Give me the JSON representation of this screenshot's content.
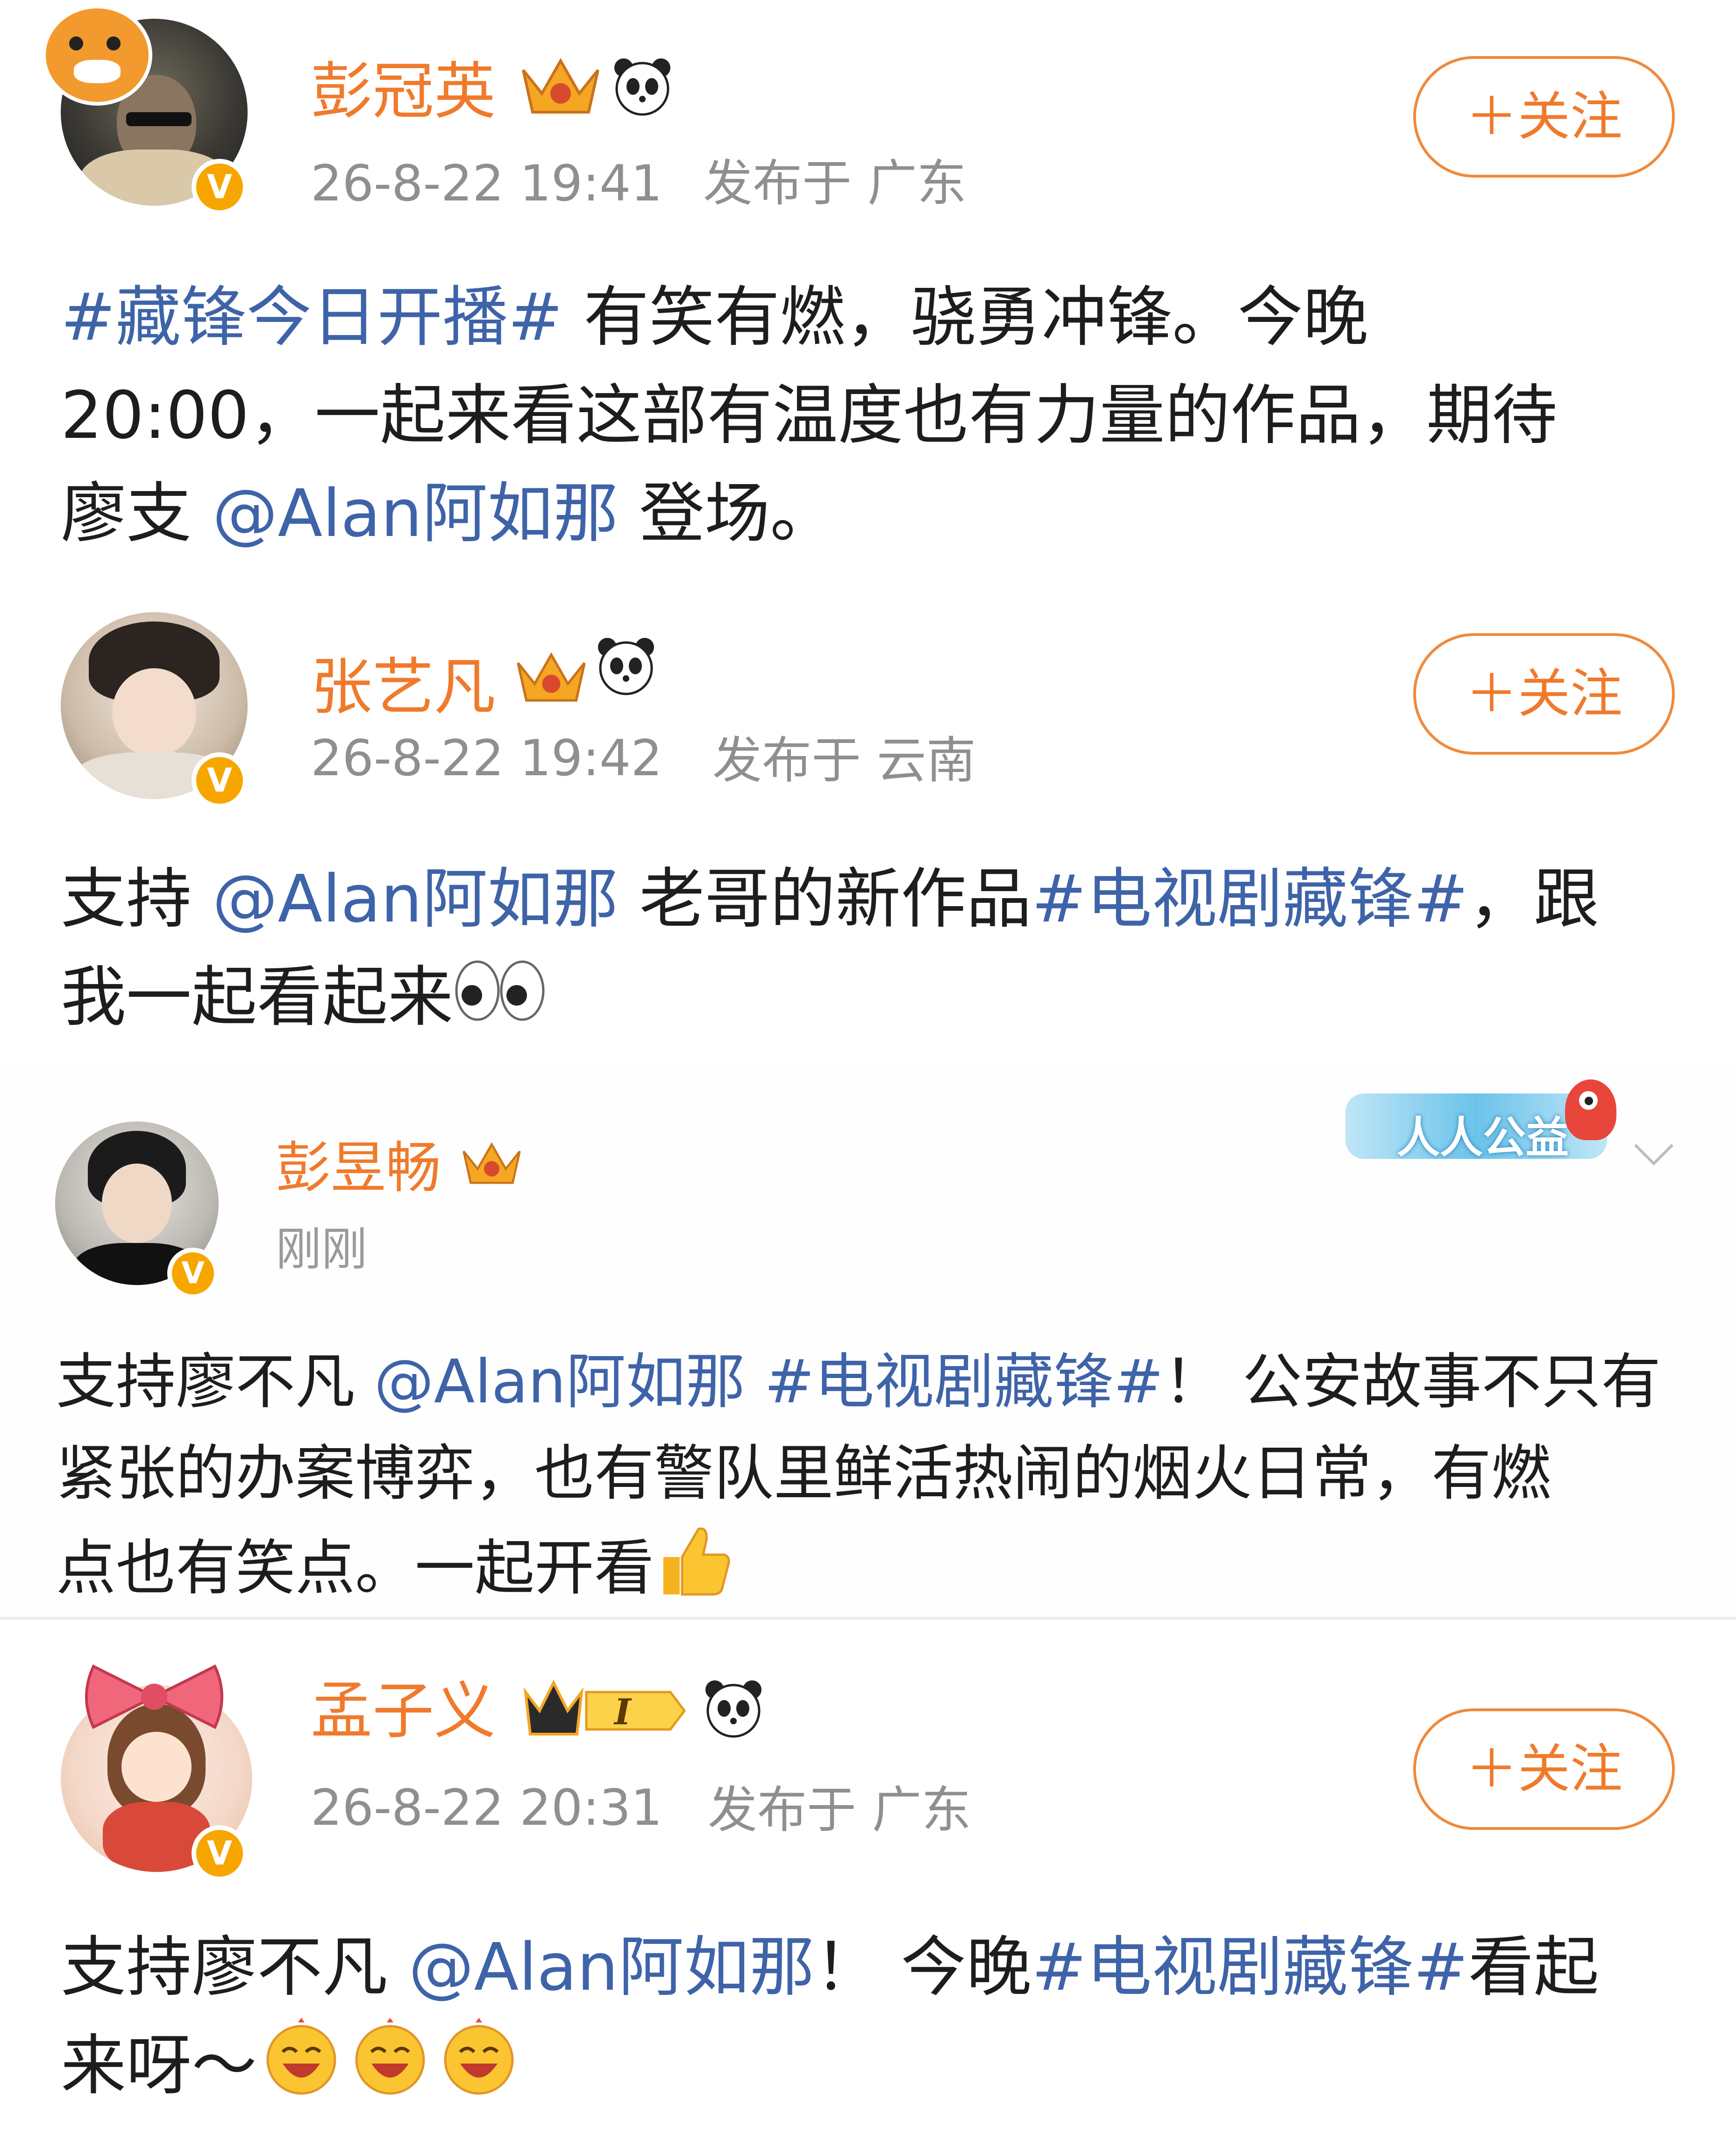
{
  "posts": [
    {
      "name": "彭冠英",
      "time": "26-8-22 19:41",
      "location": "发布于 广东",
      "follow": "＋关注",
      "text": {
        "tag1": "#藏锋今日开播#",
        "p1": " 有笑有燃，骁勇冲锋。今晚",
        "p2": "20:00，一起来看这部有温度也有力量的作品，期待",
        "p3": "廖支 ",
        "mention": "@Alan阿如那",
        "p4": " 登场。"
      }
    },
    {
      "name": "张艺凡",
      "time": "26-8-22 19:42",
      "location": "发布于 云南",
      "follow": "＋关注",
      "text": {
        "p1": "支持 ",
        "mention": "@Alan阿如那",
        "p2": " 老哥的新作品",
        "tag1": "#电视剧藏锋#",
        "p3": "，跟",
        "p4": "我一起看起来"
      }
    },
    {
      "name": "彭昱畅",
      "time": "刚刚",
      "badge": "人人公益",
      "text": {
        "p1": "支持廖不凡 ",
        "mention": "@Alan阿如那",
        "tag1": " #电视剧藏锋#",
        "p2": "！ 公安故事不只有",
        "p3": "紧张的办案博弈，也有警队里鲜活热闹的烟火日常，有燃",
        "p4": "点也有笑点。一起开看"
      }
    },
    {
      "name": "孟子义",
      "time": "26-8-22 20:31",
      "location": "发布于 广东",
      "follow": "＋关注",
      "level": "I",
      "text": {
        "p1": "支持廖不凡 ",
        "mention": "@Alan阿如那",
        "p2": "！ 今晚",
        "tag1": "#电视剧藏锋#",
        "p3": "看起",
        "p4": "来呀～"
      }
    }
  ],
  "colors": {
    "name": "#f07a2c",
    "link": "#3e63a8",
    "meta": "#8f8f8f",
    "vip": "#f7a600"
  },
  "icons": [
    "verified-v-icon",
    "crown-icon",
    "panda-icon",
    "eyes-emoji",
    "thumbs-up-emoji",
    "laughing-emoji",
    "chevron-down-icon"
  ]
}
